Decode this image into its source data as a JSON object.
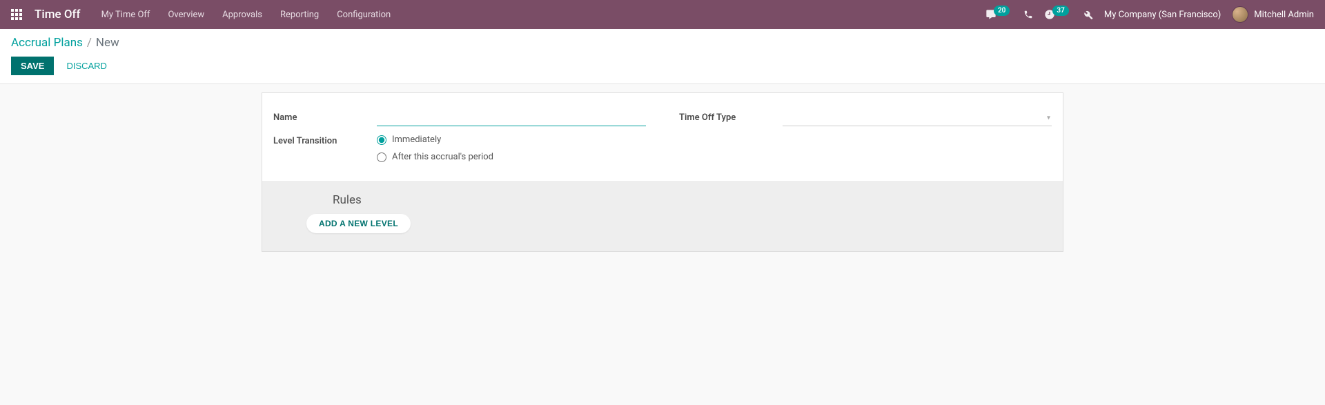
{
  "header": {
    "app_title": "Time Off",
    "nav": [
      "My Time Off",
      "Overview",
      "Approvals",
      "Reporting",
      "Configuration"
    ],
    "messages_badge": "20",
    "activities_badge": "37",
    "company": "My Company (San Francisco)",
    "user": "Mitchell Admin"
  },
  "breadcrumb": {
    "parent": "Accrual Plans",
    "current": "New"
  },
  "buttons": {
    "save": "SAVE",
    "discard": "DISCARD"
  },
  "form": {
    "name_label": "Name",
    "name_value": "",
    "time_off_type_label": "Time Off Type",
    "time_off_type_value": "",
    "level_transition_label": "Level Transition",
    "level_transition_options": {
      "immediately": "Immediately",
      "after_period": "After this accrual's period"
    }
  },
  "rules": {
    "title": "Rules",
    "add_level": "ADD A NEW LEVEL"
  }
}
